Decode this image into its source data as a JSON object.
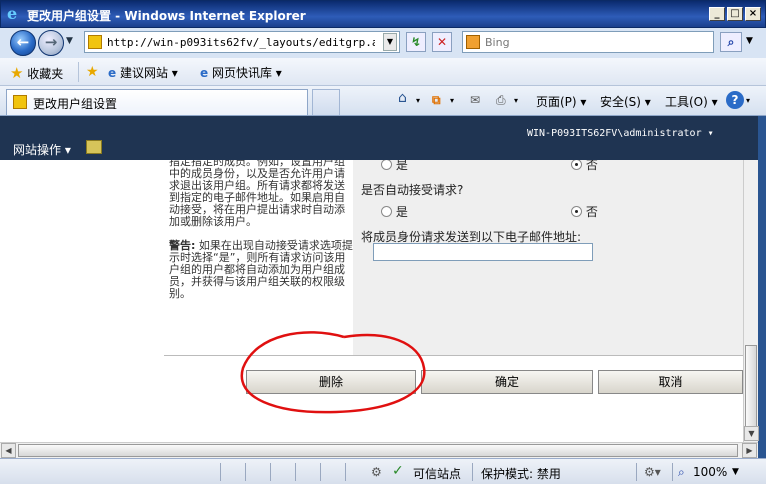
{
  "window": {
    "title": "更改用户组设置 - Windows Internet Explorer",
    "controls": [
      "_",
      "□",
      "×"
    ]
  },
  "address_bar": {
    "url": "http://win-p093its62fv/_layouts/editgrp.aspx?G",
    "search_placeholder": "Bing"
  },
  "favorites_bar": {
    "favorites_label": "收藏夹",
    "suggested_sites": "建议网站 ▾",
    "web_slice_gallery": "网页快讯库 ▾"
  },
  "tabs": [
    {
      "label": "更改用户组设置"
    }
  ],
  "command_bar": {
    "page": "页面(P) ▾",
    "safety": "安全(S) ▾",
    "tools": "工具(O) ▾",
    "help": "?"
  },
  "sharepoint": {
    "user": "WIN-P093ITS62FV\\administrator ▾",
    "site_actions": "网站操作 ▾"
  },
  "content": {
    "left_description": "指定指定的成员。例如，设置用户组中的成员身份，以及是否允许用户请求退出该用户组。所有请求都将发送到指定的电子邮件地址。如果启用自动接受，将在用户提出请求时自动添加或删除该用户。",
    "warning_label": "警告:",
    "warning_text": "如果在出现自动接受请求选项提示时选择“是”，则所有请求访问该用户组的用户都将自动添加为用户组成员，并获得与该用户组关联的权限级别。",
    "top_radio": {
      "yes": "是",
      "no": "否",
      "selected": "no"
    },
    "auto_accept_question": "是否自动接受请求?",
    "auto_accept": {
      "yes": "是",
      "no": "否",
      "selected": "no"
    },
    "email_label": "将成员身份请求发送到以下电子邮件地址:",
    "email_value": "",
    "buttons": {
      "delete": "删除",
      "ok": "确定",
      "cancel": "取消"
    }
  },
  "status_bar": {
    "zone": "可信站点",
    "protected_mode": "保护模式: 禁用",
    "zoom": "100%"
  }
}
